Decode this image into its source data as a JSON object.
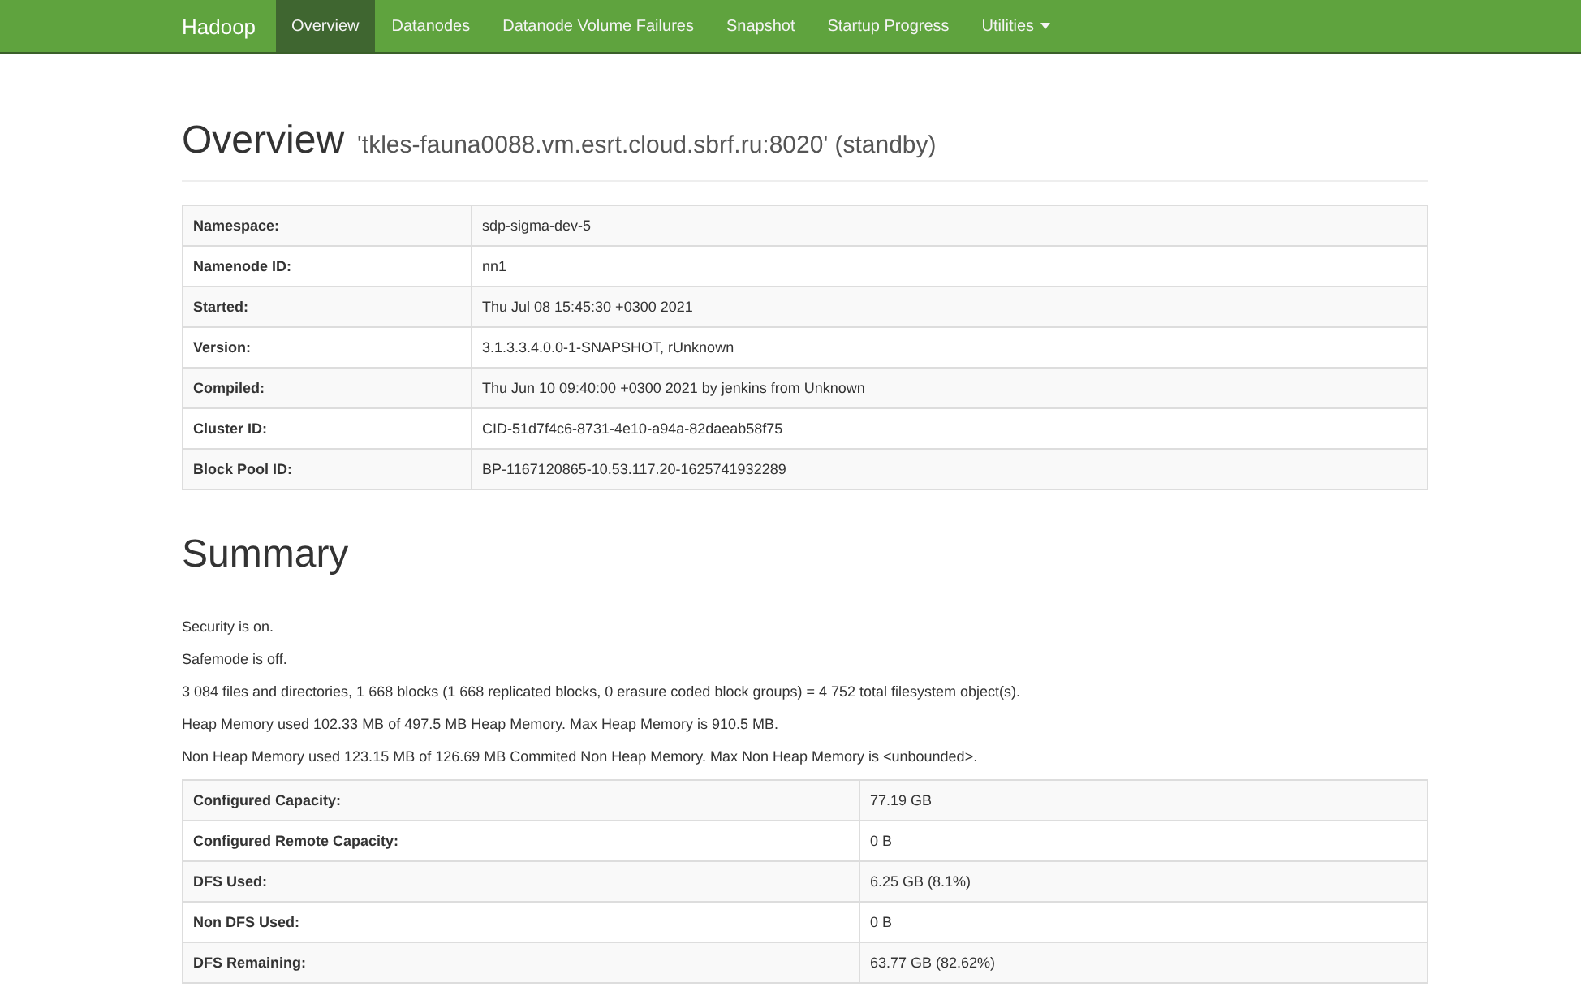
{
  "navbar": {
    "brand": "Hadoop",
    "items": [
      {
        "label": "Overview",
        "selected": true,
        "dropdown": false
      },
      {
        "label": "Datanodes",
        "selected": false,
        "dropdown": false
      },
      {
        "label": "Datanode Volume Failures",
        "selected": false,
        "dropdown": false
      },
      {
        "label": "Snapshot",
        "selected": false,
        "dropdown": false
      },
      {
        "label": "Startup Progress",
        "selected": false,
        "dropdown": false
      },
      {
        "label": "Utilities",
        "selected": false,
        "dropdown": true
      }
    ]
  },
  "overview": {
    "title": "Overview",
    "subtitle": "'tkles-fauna0088.vm.esrt.cloud.sbrf.ru:8020' (standby)",
    "rows": [
      {
        "label": "Namespace:",
        "value": "sdp-sigma-dev-5"
      },
      {
        "label": "Namenode ID:",
        "value": "nn1"
      },
      {
        "label": "Started:",
        "value": "Thu Jul 08 15:45:30 +0300 2021"
      },
      {
        "label": "Version:",
        "value": "3.1.3.3.4.0.0-1-SNAPSHOT, rUnknown"
      },
      {
        "label": "Compiled:",
        "value": "Thu Jun 10 09:40:00 +0300 2021 by jenkins from Unknown"
      },
      {
        "label": "Cluster ID:",
        "value": "CID-51d7f4c6-8731-4e10-a94a-82daeab58f75"
      },
      {
        "label": "Block Pool ID:",
        "value": "BP-1167120865-10.53.117.20-1625741932289"
      }
    ]
  },
  "summary": {
    "title": "Summary",
    "lines": [
      "Security is on.",
      "Safemode is off.",
      "3 084 files and directories, 1 668 blocks (1 668 replicated blocks, 0 erasure coded block groups) = 4 752 total filesystem object(s).",
      "Heap Memory used 102.33 MB of 497.5 MB Heap Memory. Max Heap Memory is 910.5 MB.",
      "Non Heap Memory used 123.15 MB of 126.69 MB Commited Non Heap Memory. Max Non Heap Memory is <unbounded>."
    ],
    "rows": [
      {
        "label": "Configured Capacity:",
        "value": "77.19 GB"
      },
      {
        "label": "Configured Remote Capacity:",
        "value": "0 B"
      },
      {
        "label": "DFS Used:",
        "value": "6.25 GB (8.1%)"
      },
      {
        "label": "Non DFS Used:",
        "value": "0 B"
      },
      {
        "label": "DFS Remaining:",
        "value": "63.77 GB (82.62%)"
      }
    ]
  }
}
